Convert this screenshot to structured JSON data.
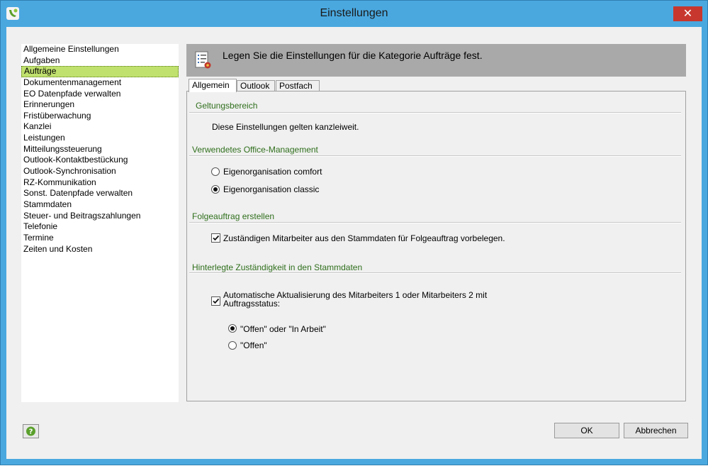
{
  "window": {
    "title": "Einstellungen",
    "close_glyph": "✕"
  },
  "sidebar": {
    "items": [
      {
        "label": "Allgemeine Einstellungen"
      },
      {
        "label": "Aufgaben"
      },
      {
        "label": "Aufträge"
      },
      {
        "label": "Dokumentenmanagement"
      },
      {
        "label": "EO Datenpfade verwalten"
      },
      {
        "label": "Erinnerungen"
      },
      {
        "label": "Fristüberwachung"
      },
      {
        "label": "Kanzlei"
      },
      {
        "label": "Leistungen"
      },
      {
        "label": "Mitteilungssteuerung"
      },
      {
        "label": "Outlook-Kontaktbestückung"
      },
      {
        "label": "Outlook-Synchronisation"
      },
      {
        "label": "RZ-Kommunikation"
      },
      {
        "label": "Sonst. Datenpfade verwalten"
      },
      {
        "label": "Stammdaten"
      },
      {
        "label": "Steuer- und Beitragszahlungen"
      },
      {
        "label": "Telefonie"
      },
      {
        "label": "Termine"
      },
      {
        "label": "Zeiten und Kosten"
      }
    ],
    "selected": "Aufträge"
  },
  "header": {
    "text": "Legen Sie die Einstellungen für die Kategorie Aufträge fest.",
    "icon": "settings-list-icon"
  },
  "tabs": [
    {
      "label": "Allgemein",
      "active": true
    },
    {
      "label": "Outlook",
      "active": false
    },
    {
      "label": "Postfach",
      "active": false
    }
  ],
  "panel": {
    "scope": {
      "title": "Geltungsbereich",
      "text": "Diese Einstellungen gelten kanzleiweit."
    },
    "office": {
      "title": "Verwendetes Office-Management",
      "options": [
        {
          "label": "Eigenorganisation comfort",
          "checked": false
        },
        {
          "label": "Eigenorganisation classic",
          "checked": true
        }
      ]
    },
    "followup": {
      "title": "Folgeauftrag erstellen",
      "checkbox": {
        "label": "Zuständigen Mitarbeiter aus den Stammdaten für Folgeauftrag vorbelegen.",
        "checked": true
      }
    },
    "responsibility": {
      "title": "Hinterlegte Zuständigkeit in den Stammdaten",
      "checkbox": {
        "line1": "Automatische Aktualisierung des Mitarbeiters 1 oder Mitarbeiters 2 mit",
        "line2": "Auftragsstatus:",
        "checked": true
      },
      "options": [
        {
          "label": "\"Offen\" oder \"In Arbeit\"",
          "checked": true
        },
        {
          "label": "\"Offen\"",
          "checked": false
        }
      ]
    }
  },
  "footer": {
    "help_icon": "help-icon",
    "ok_label": "OK",
    "cancel_label": "Abbrechen"
  },
  "colors": {
    "titlebar": "#4aa8df",
    "close": "#c8372d",
    "selection": "#c0e16e",
    "group_title": "#2f6f1c",
    "header_band": "#a9a9a9"
  }
}
